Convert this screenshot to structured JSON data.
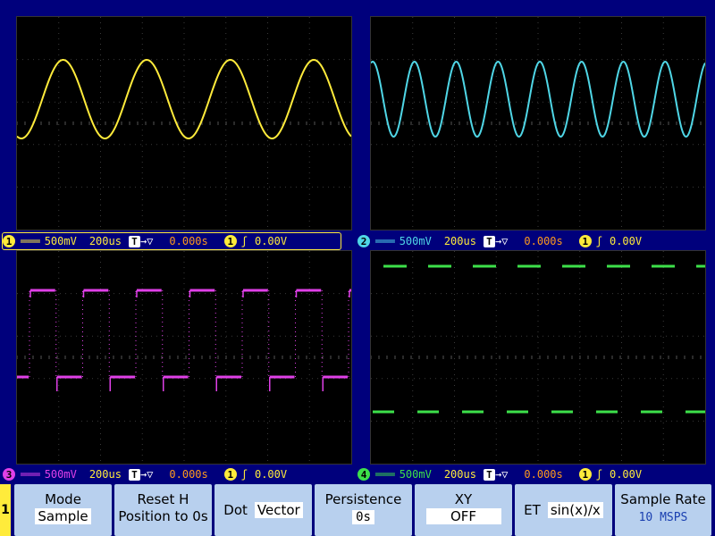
{
  "channels": [
    {
      "id": "1",
      "color": "#ffeb3b",
      "coupling": "═══",
      "volts_div": "500mV",
      "timebase": "200us",
      "trigger_icon": "T",
      "trigger_arrow": "→▽",
      "delay": "0.000s",
      "trig_source": "1",
      "edge": "ʃ",
      "trig_level": "0.00V",
      "waveform": "sine",
      "cycles": 4
    },
    {
      "id": "2",
      "color": "#4fd6e6",
      "coupling": "═══",
      "volts_div": "500mV",
      "timebase": "200us",
      "trigger_icon": "T",
      "trigger_arrow": "→▽",
      "delay": "0.000s",
      "trig_source": "1",
      "edge": "ʃ",
      "trig_level": "0.00V",
      "waveform": "sine",
      "cycles": 8
    },
    {
      "id": "3",
      "color": "#e040e8",
      "coupling": "═══",
      "volts_div": "500mV",
      "timebase": "200us",
      "trigger_icon": "T",
      "trigger_arrow": "→▽",
      "delay": "0.000s",
      "trig_source": "1",
      "edge": "ʃ",
      "trig_level": "0.00V",
      "waveform": "square",
      "cycles": 6
    },
    {
      "id": "4",
      "color": "#3de04a",
      "coupling": "═══",
      "volts_div": "500mV",
      "timebase": "200us",
      "trigger_icon": "T",
      "trigger_arrow": "→▽",
      "delay": "0.000s",
      "trig_source": "1",
      "edge": "ʃ",
      "trig_level": "0.00V",
      "waveform": "square-dots",
      "cycles": 7
    }
  ],
  "menu": {
    "active_channel": "1",
    "mode": {
      "title": "Mode",
      "value": "Sample"
    },
    "reset_h": {
      "title": "Reset H",
      "value": "Position to 0s"
    },
    "dot": {
      "title": "Dot",
      "value": "Vector"
    },
    "persistence": {
      "title": "Persistence",
      "value": "0s"
    },
    "xy": {
      "title": "XY",
      "value": "OFF"
    },
    "et": {
      "title": "ET",
      "value": "sin(x)/x"
    },
    "sample_rate": {
      "title": "Sample Rate",
      "value": "10 MSPS"
    }
  },
  "colors": {
    "background": "#00007c",
    "menu_button": "#b8d0ee",
    "delay": "#ff9a1c"
  }
}
